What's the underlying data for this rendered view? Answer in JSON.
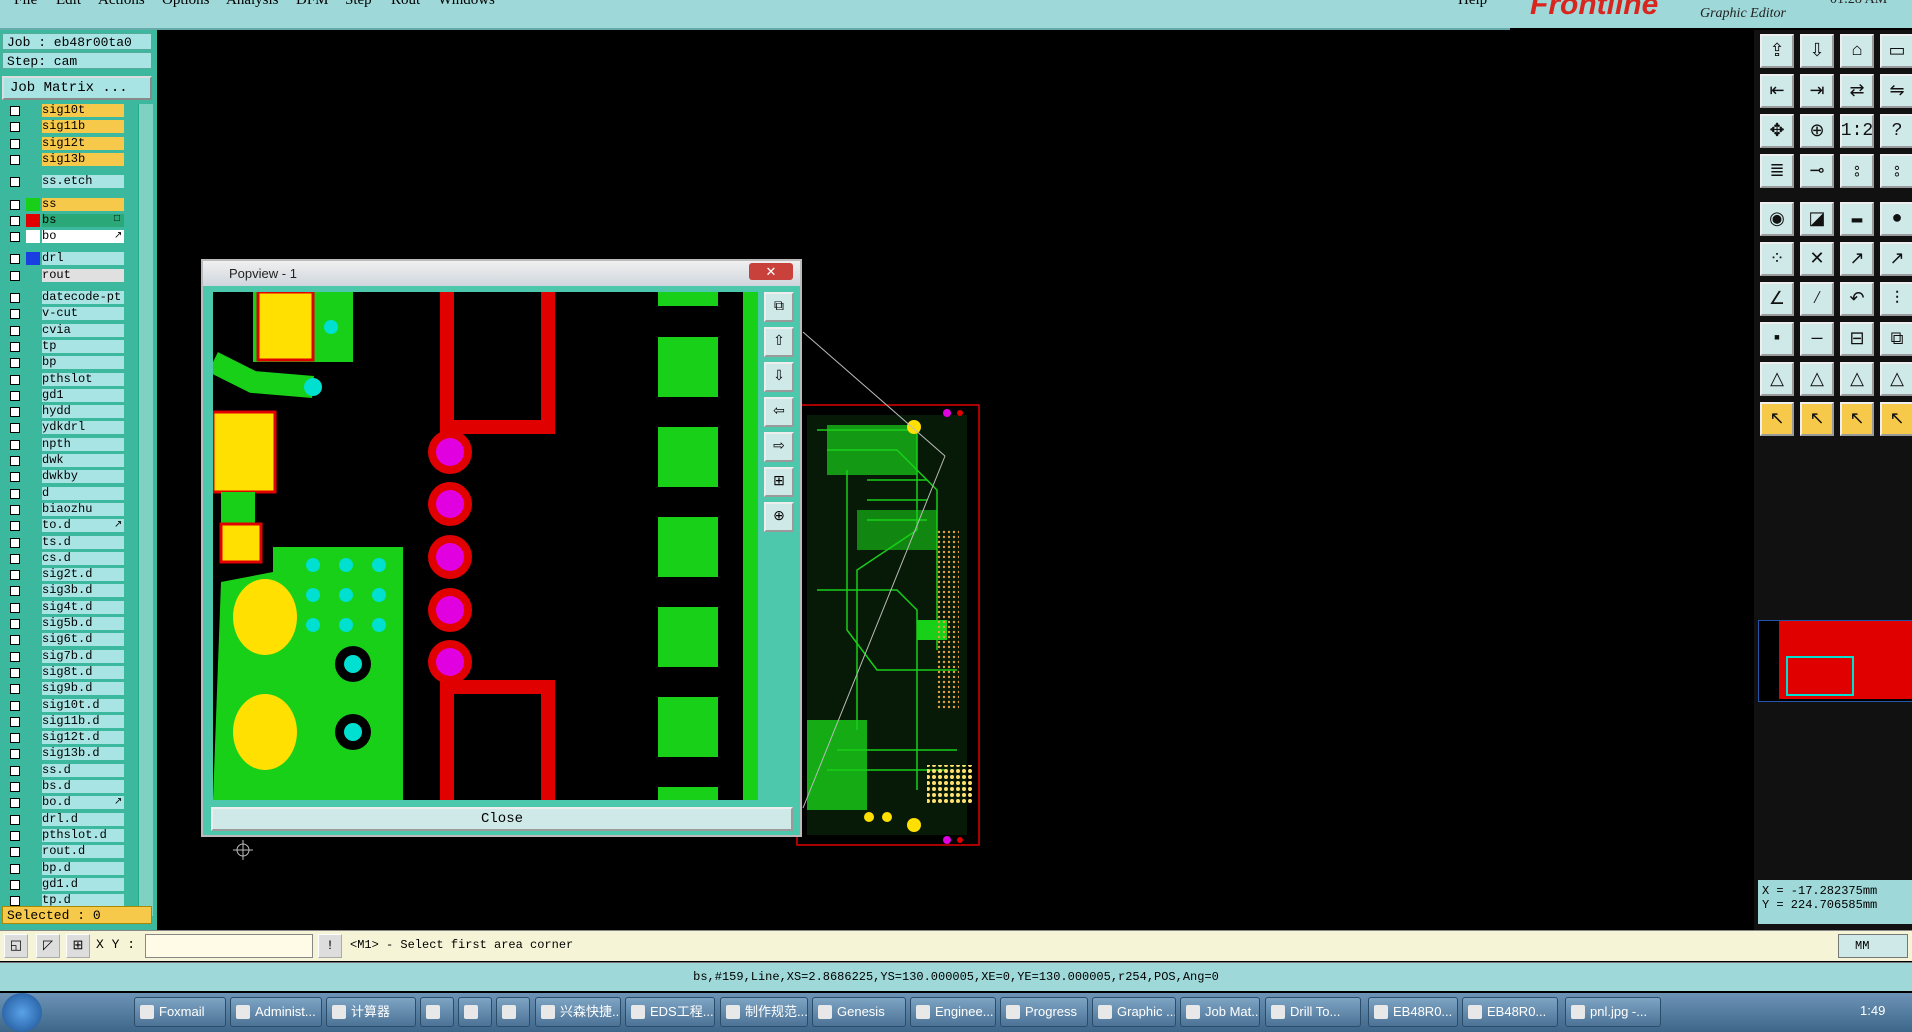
{
  "menu": [
    "File",
    "Edit",
    "Actions",
    "Options",
    "Analysis",
    "DFM",
    "Step",
    "Rout",
    "Windows"
  ],
  "menu_help": "Help",
  "brand": {
    "logo": "Frontline",
    "subtitle": "Graphic Editor",
    "time": "01:28 AM"
  },
  "job": {
    "job_label": "Job : eb48r00ta0",
    "step_label": "Step: cam",
    "matrix_button": "Job Matrix ..."
  },
  "layers": [
    {
      "name": "sig10t",
      "color": "#f7c94a"
    },
    {
      "name": "sig11b",
      "color": "#f7c94a"
    },
    {
      "name": "sig12t",
      "color": "#f7c94a"
    },
    {
      "name": "sig13b",
      "color": "#f7c94a"
    },
    {
      "name": "ss.etch",
      "color": "#a8e4e4"
    },
    {
      "name": "ss",
      "color": "#f7c94a",
      "swatch": "#19d019"
    },
    {
      "name": "bs",
      "color": "#2aa878",
      "swatch": "#e00000",
      "marker": "□"
    },
    {
      "name": "bo",
      "color": "#ffffff",
      "swatch": "#ffffff",
      "marker": "↗"
    },
    {
      "name": "drl",
      "color": "#a8e4e4",
      "swatch": "#1a3fe0"
    },
    {
      "name": "rout",
      "color": "#e0e0e0"
    },
    {
      "name": "datecode-pt",
      "color": "#a8e4e4"
    },
    {
      "name": "v-cut",
      "color": "#a8e4e4"
    },
    {
      "name": "cvia",
      "color": "#a8e4e4"
    },
    {
      "name": "tp",
      "color": "#a8e4e4"
    },
    {
      "name": "bp",
      "color": "#a8e4e4"
    },
    {
      "name": "pthslot",
      "color": "#a8e4e4"
    },
    {
      "name": "gd1",
      "color": "#a8e4e4"
    },
    {
      "name": "hydd",
      "color": "#a8e4e4"
    },
    {
      "name": "ydkdrl",
      "color": "#a8e4e4"
    },
    {
      "name": "npth",
      "color": "#a8e4e4"
    },
    {
      "name": "dwk",
      "color": "#a8e4e4"
    },
    {
      "name": "dwkby",
      "color": "#a8e4e4"
    },
    {
      "name": "d",
      "color": "#a8e4e4"
    },
    {
      "name": "biaozhu",
      "color": "#a8e4e4"
    },
    {
      "name": "to.d",
      "color": "#a8e4e4",
      "marker": "↗"
    },
    {
      "name": "ts.d",
      "color": "#a8e4e4"
    },
    {
      "name": "cs.d",
      "color": "#a8e4e4"
    },
    {
      "name": "sig2t.d",
      "color": "#a8e4e4"
    },
    {
      "name": "sig3b.d",
      "color": "#a8e4e4"
    },
    {
      "name": "sig4t.d",
      "color": "#a8e4e4"
    },
    {
      "name": "sig5b.d",
      "color": "#a8e4e4"
    },
    {
      "name": "sig6t.d",
      "color": "#a8e4e4"
    },
    {
      "name": "sig7b.d",
      "color": "#a8e4e4"
    },
    {
      "name": "sig8t.d",
      "color": "#a8e4e4"
    },
    {
      "name": "sig9b.d",
      "color": "#a8e4e4"
    },
    {
      "name": "sig10t.d",
      "color": "#a8e4e4"
    },
    {
      "name": "sig11b.d",
      "color": "#a8e4e4"
    },
    {
      "name": "sig12t.d",
      "color": "#a8e4e4"
    },
    {
      "name": "sig13b.d",
      "color": "#a8e4e4"
    },
    {
      "name": "ss.d",
      "color": "#a8e4e4"
    },
    {
      "name": "bs.d",
      "color": "#a8e4e4"
    },
    {
      "name": "bo.d",
      "color": "#a8e4e4",
      "marker": "↗"
    },
    {
      "name": "drl.d",
      "color": "#a8e4e4"
    },
    {
      "name": "pthslot.d",
      "color": "#a8e4e4"
    },
    {
      "name": "rout.d",
      "color": "#a8e4e4"
    },
    {
      "name": "bp.d",
      "color": "#a8e4e4"
    },
    {
      "name": "gd1.d",
      "color": "#a8e4e4"
    },
    {
      "name": "tp.d",
      "color": "#a8e4e4"
    }
  ],
  "selected_label": "Selected : 0",
  "popview": {
    "title": "Popview - 1",
    "close_label": "Close",
    "close_x": "✕"
  },
  "coords": {
    "x": "X = -17.282375mm",
    "y": "Y = 224.706585mm"
  },
  "cmd": {
    "xy_label": "X Y :",
    "prompt": "<M1> - Select first area corner",
    "units": "MM"
  },
  "status_text": "bs,#159,Line,XS=2.8686225,YS=130.000005,XE=0,YE=130.000005,r254,POS,Ang=0",
  "taskbar": {
    "items": [
      "Foxmail",
      "Administ...",
      "计算器",
      "",
      "",
      "",
      "兴森快捷...",
      "EDS工程...",
      "制作规范...",
      "Genesis",
      "Enginee...",
      "Progress",
      "Graphic ...",
      "Job Mat...",
      "Drill To...",
      "EB48R0...",
      "EB48R0...",
      "pnl.jpg -..."
    ],
    "clock": "1:49"
  },
  "colors": {
    "pcb_green": "#19d019",
    "pcb_red": "#e00000",
    "pcb_yellow": "#ffe000",
    "pcb_magenta": "#e000e0",
    "pcb_cyan": "#00e0d0",
    "panel": "#3cb89e"
  }
}
